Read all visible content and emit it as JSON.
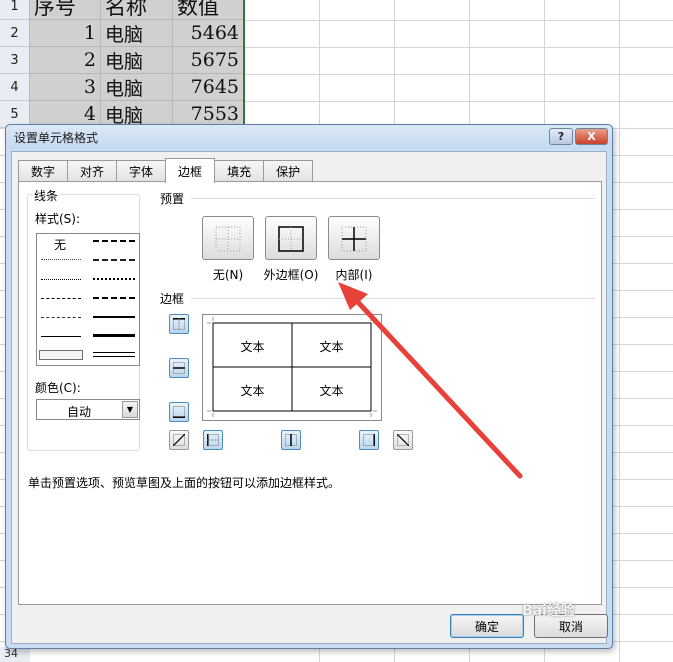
{
  "sheet": {
    "row_numbers": [
      "1",
      "2",
      "3",
      "4",
      "5"
    ],
    "headers": [
      "序号",
      "名称",
      "数值"
    ],
    "rows": [
      [
        "1",
        "电脑",
        "5464"
      ],
      [
        "2",
        "电脑",
        "5675"
      ],
      [
        "3",
        "电脑",
        "7645"
      ],
      [
        "4",
        "电脑",
        "7553"
      ]
    ],
    "bottom_row_number": "34"
  },
  "dialog": {
    "title": "设置单元格格式",
    "help_label": "?",
    "close_label": "X",
    "tabs": [
      "数字",
      "对齐",
      "字体",
      "边框",
      "填充",
      "保护"
    ],
    "active_tab": "边框",
    "line_group": {
      "title": "线条",
      "style_label": "样式(S):",
      "none_style": "无",
      "color_label": "颜色(C):",
      "color_value": "自动"
    },
    "presets": {
      "title": "预置",
      "items": [
        "无(N)",
        "外边框(O)",
        "内部(I)"
      ]
    },
    "border": {
      "title": "边框",
      "preview_text": [
        "文本",
        "文本",
        "文本",
        "文本"
      ]
    },
    "hint": "单击预置选项、预览草图及上面的按钮可以添加边框样式。",
    "ok_label": "确定",
    "cancel_label": "取消"
  },
  "colors": {
    "arrow": "#e8413a",
    "selection_border": "#2f7a3a",
    "accent_button": "#4f8dbf"
  },
  "watermark": "Bai经验"
}
